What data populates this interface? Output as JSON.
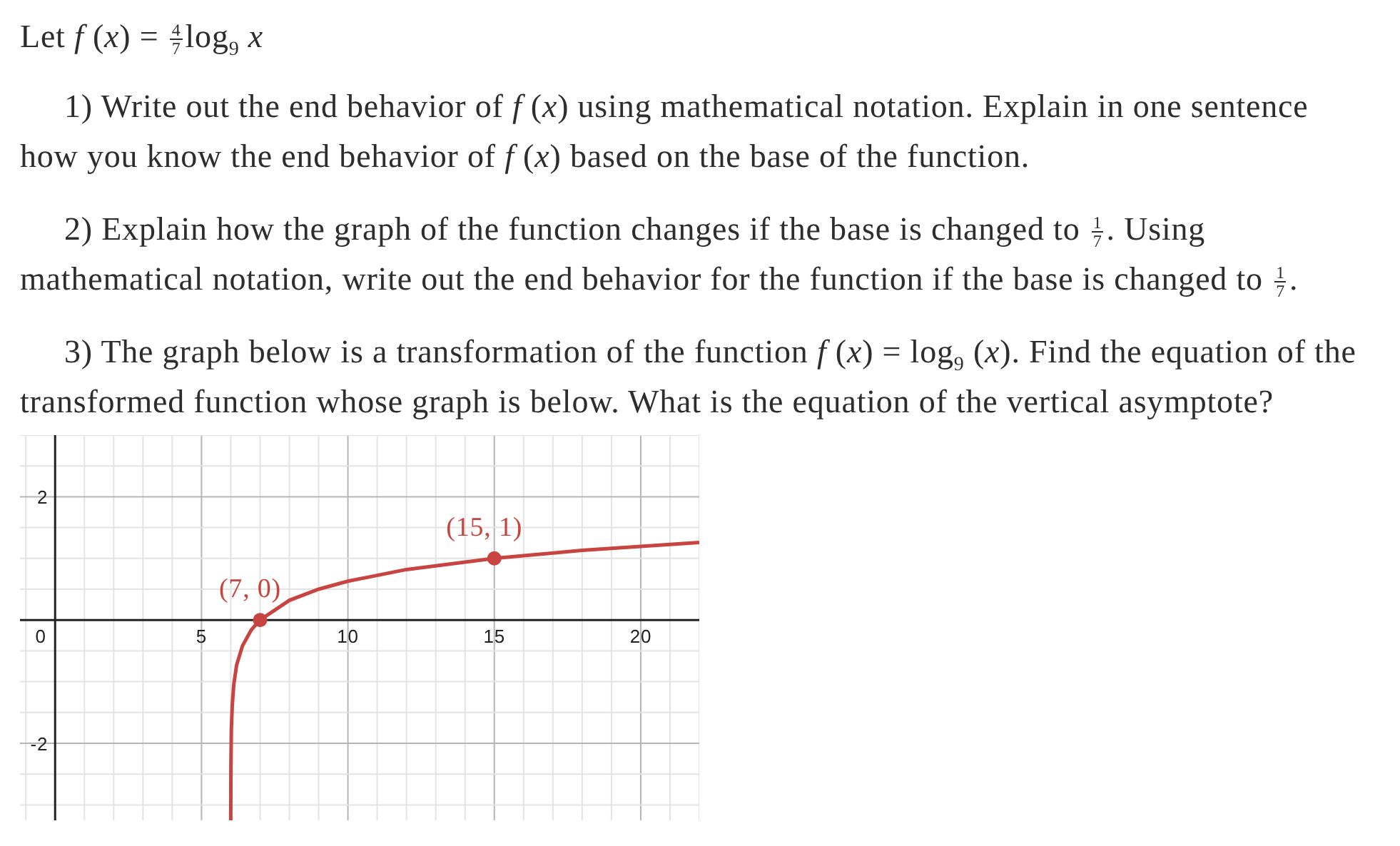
{
  "intro": [
    {
      "kind": "text",
      "text": "Let *f* (*x*) = "
    },
    {
      "kind": "frac",
      "num": "4",
      "den": "7"
    },
    {
      "kind": "text",
      "text": "log$_{9}$ *x*"
    }
  ],
  "questions": [
    [
      {
        "kind": "text",
        "text": "1) Write out the end behavior of *f* (*x*) using mathematical notation. Explain in one sentence how you know the end behavior of *f* (*x*) based on the base of the function."
      }
    ],
    [
      {
        "kind": "text",
        "text": "2) Explain how the graph of the function changes if the base is changed to "
      },
      {
        "kind": "frac",
        "num": "1",
        "den": "7"
      },
      {
        "kind": "text",
        "text": ". Using mathematical notation, write out the end behavior for the function if the base is changed to "
      },
      {
        "kind": "frac",
        "num": "1",
        "den": "7"
      },
      {
        "kind": "text",
        "text": "."
      }
    ],
    [
      {
        "kind": "text",
        "text": "3) The graph below is a transformation of the function *f* (*x*) = log$_{9}$ (*x*). Find the equation of the transformed function whose graph is below. What is the equation of the vertical asymptote?"
      }
    ]
  ],
  "graph": {
    "chart_data": {
      "type": "line",
      "grid": true,
      "xlim": [
        -1.2,
        22
      ],
      "ylim": [
        -3.25,
        3
      ],
      "xticks": [
        0,
        5,
        10,
        15,
        20
      ],
      "yticks": [
        -2,
        2
      ],
      "x": [
        6.0008,
        6.001,
        6.005,
        6.02,
        6.05,
        6.1,
        6.2,
        6.4,
        6.7,
        7,
        8,
        9,
        10,
        12,
        15,
        18,
        22
      ],
      "series": [
        {
          "color": "#c74440",
          "values": [
            -3.25,
            -3.14,
            -2.41,
            -1.78,
            -1.36,
            -1.05,
            -0.73,
            -0.42,
            -0.16,
            0,
            0.32,
            0.5,
            0.63,
            0.82,
            1,
            1.13,
            1.26
          ]
        }
      ],
      "annotations": [
        {
          "x": 7,
          "y": 0,
          "text": "(7, 0)"
        },
        {
          "x": 15,
          "y": 1,
          "text": "(15, 1)"
        }
      ]
    }
  }
}
